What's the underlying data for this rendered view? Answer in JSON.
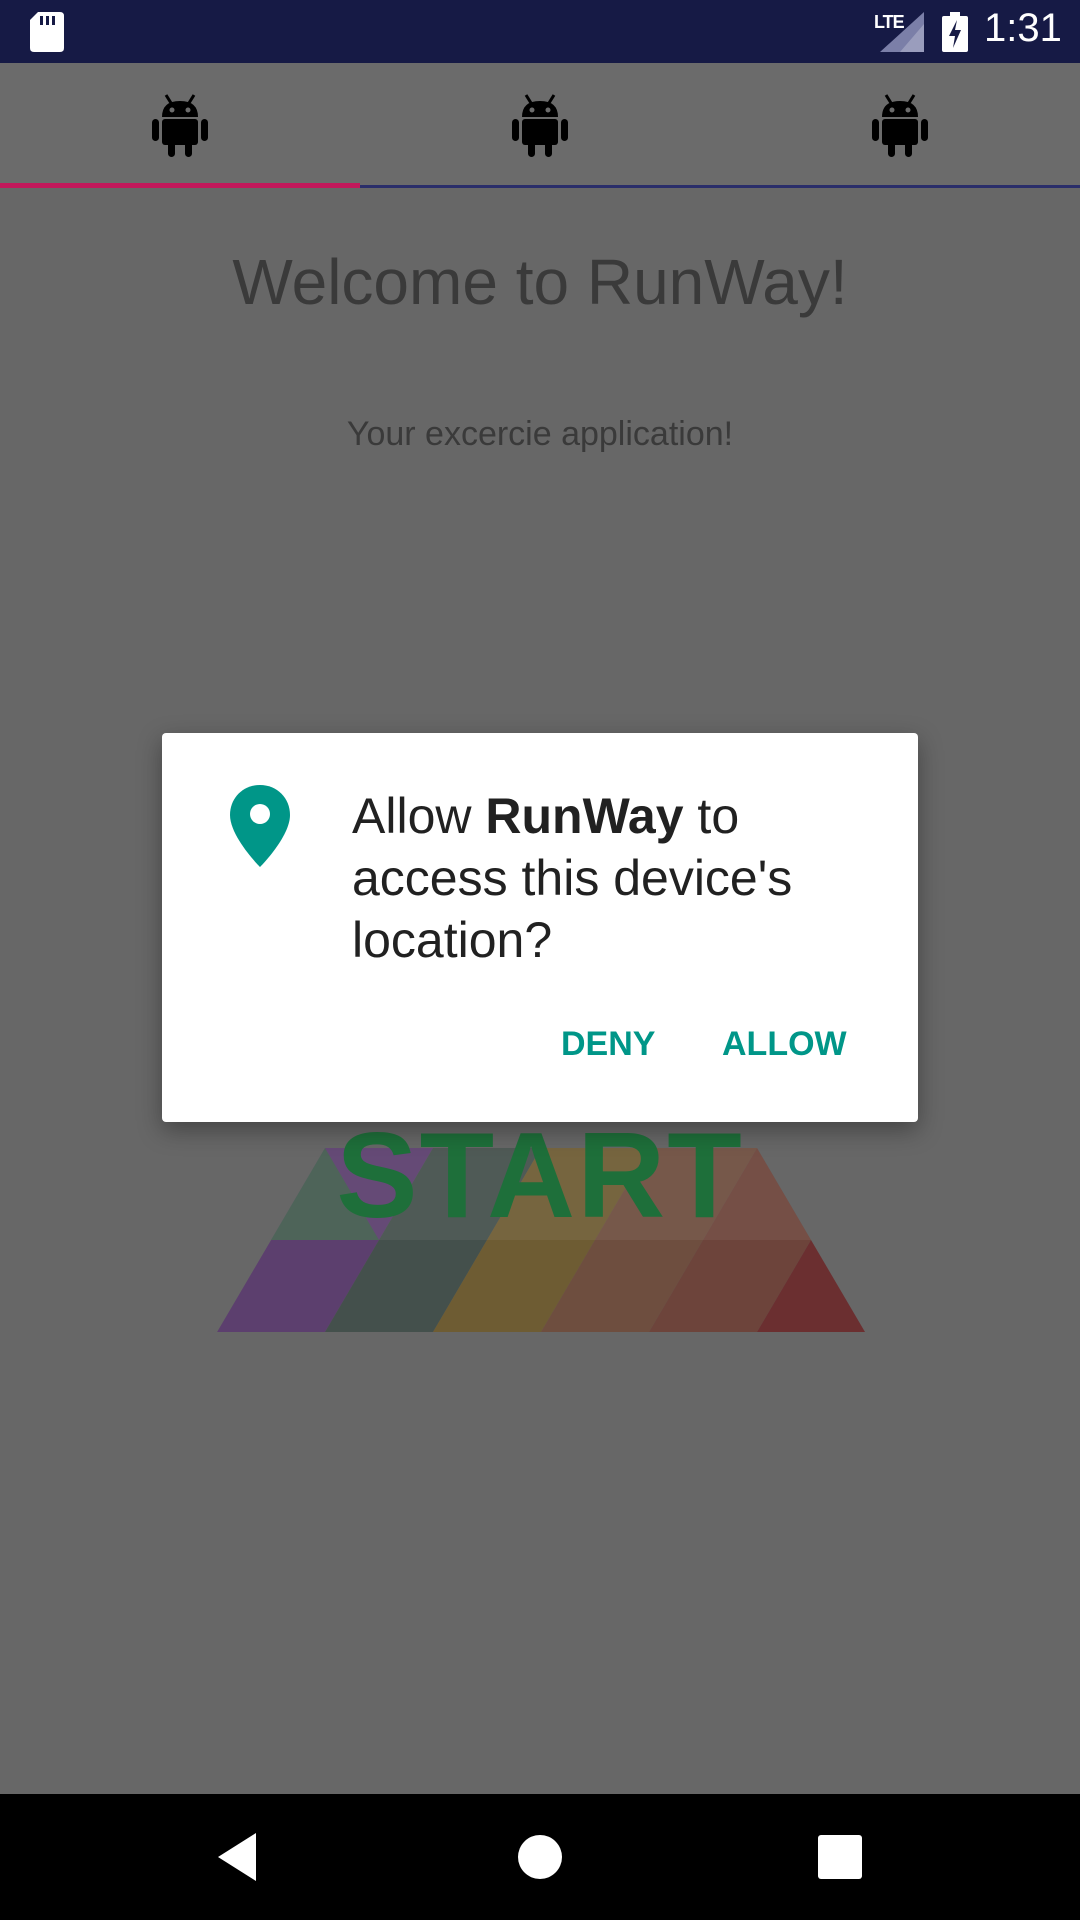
{
  "status_bar": {
    "network_label": "LTE",
    "time": "1:31",
    "icons": [
      "sd-card-icon",
      "signal-icon",
      "battery-charging-icon"
    ]
  },
  "tabs": [
    {
      "icon": "android-icon",
      "selected": true
    },
    {
      "icon": "android-icon",
      "selected": false
    },
    {
      "icon": "android-icon",
      "selected": false
    }
  ],
  "main": {
    "title": "Welcome to RunWay!",
    "subtitle": "Your excercie application!",
    "start_label": "START"
  },
  "dialog": {
    "icon": "location-pin-icon",
    "message_prefix": "Allow ",
    "app_name": "RunWay",
    "message_suffix": " to access this device's location?",
    "deny_label": "DENY",
    "allow_label": "ALLOW"
  },
  "navigation": {
    "icons": [
      "back-icon",
      "home-icon",
      "recents-icon"
    ]
  },
  "colors": {
    "status_bar": "#161a45",
    "tab_indicator": "#c2185b",
    "accent": "#009688",
    "scrim_background": "#676767"
  }
}
